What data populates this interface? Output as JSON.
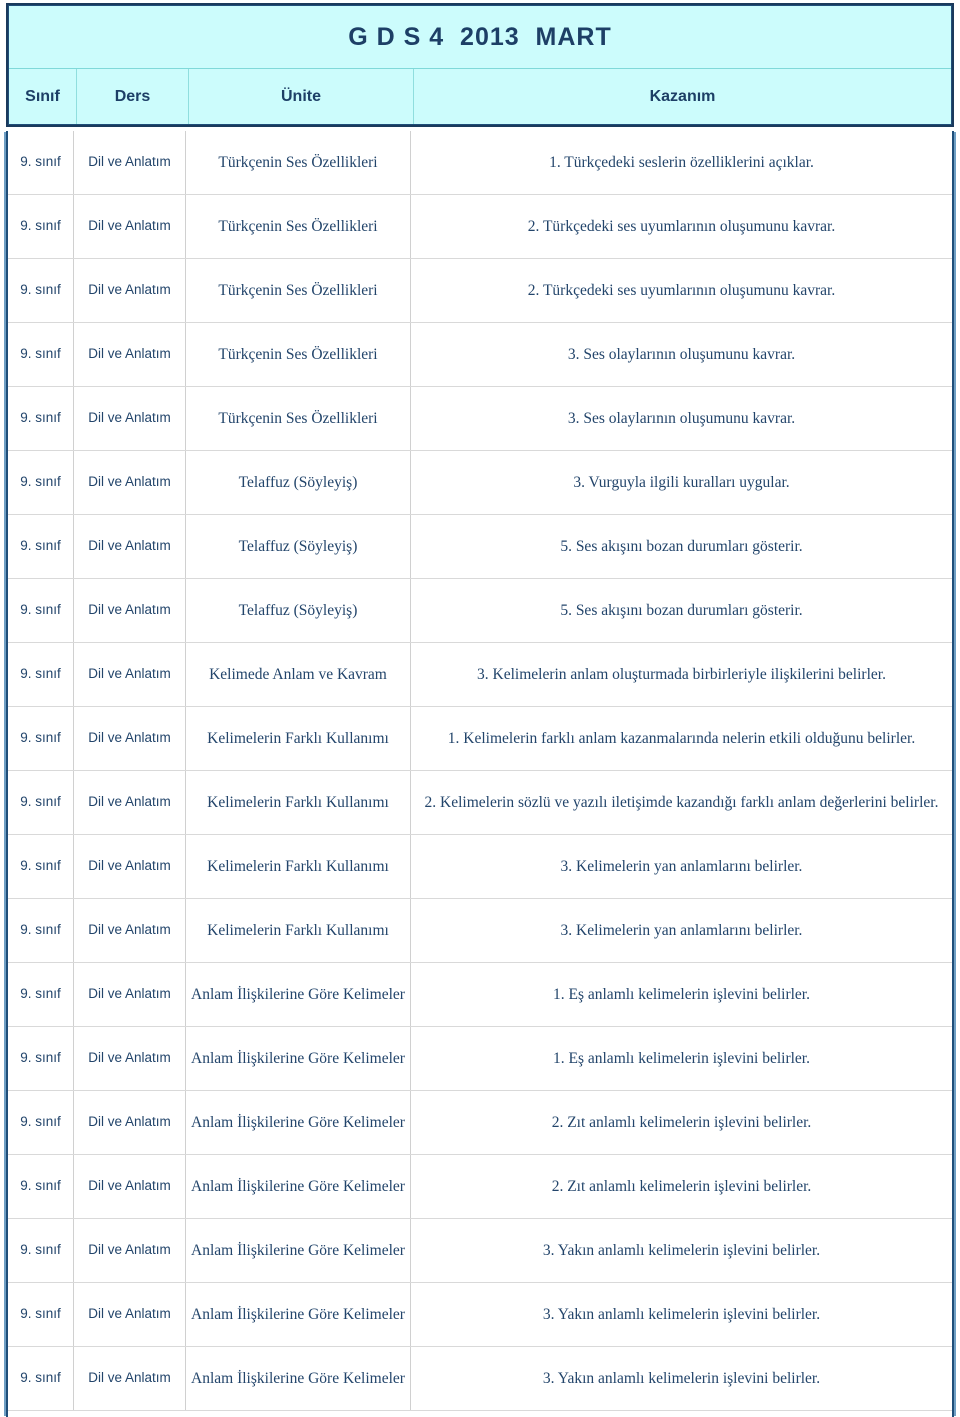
{
  "document": {
    "title": "G D S 4  2013  MART",
    "accent_header_bg": "#ccfcfc",
    "accent_text": "#1d3f66",
    "body_text": "#23456b",
    "border": "#1f4e79"
  },
  "table": {
    "columns": [
      {
        "key": "sinif",
        "label": "Sınıf"
      },
      {
        "key": "ders",
        "label": "Ders"
      },
      {
        "key": "unite",
        "label": "Ünite"
      },
      {
        "key": "kazanim",
        "label": "Kazanım"
      }
    ],
    "rows": [
      {
        "sinif": "9. sınıf",
        "ders": "Dil ve Anlatım",
        "unite": "Türkçenin Ses Özellikleri",
        "kazanim": "1. Türkçedeki seslerin özelliklerini açıklar."
      },
      {
        "sinif": "9. sınıf",
        "ders": "Dil ve Anlatım",
        "unite": "Türkçenin Ses Özellikleri",
        "kazanim": "2. Türkçedeki ses uyumlarının oluşumunu kavrar."
      },
      {
        "sinif": "9. sınıf",
        "ders": "Dil ve Anlatım",
        "unite": "Türkçenin Ses Özellikleri",
        "kazanim": "2. Türkçedeki ses uyumlarının oluşumunu kavrar."
      },
      {
        "sinif": "9. sınıf",
        "ders": "Dil ve Anlatım",
        "unite": "Türkçenin Ses Özellikleri",
        "kazanim": "3. Ses olaylarının oluşumunu kavrar."
      },
      {
        "sinif": "9. sınıf",
        "ders": "Dil ve Anlatım",
        "unite": "Türkçenin Ses Özellikleri",
        "kazanim": "3. Ses olaylarının oluşumunu kavrar."
      },
      {
        "sinif": "9. sınıf",
        "ders": "Dil ve Anlatım",
        "unite": "Telaffuz (Söyleyiş)",
        "kazanim": "3. Vurguyla ilgili kuralları uygular."
      },
      {
        "sinif": "9. sınıf",
        "ders": "Dil ve Anlatım",
        "unite": "Telaffuz (Söyleyiş)",
        "kazanim": "5. Ses akışını bozan durumları gösterir."
      },
      {
        "sinif": "9. sınıf",
        "ders": "Dil ve Anlatım",
        "unite": "Telaffuz (Söyleyiş)",
        "kazanim": "5. Ses akışını bozan durumları gösterir."
      },
      {
        "sinif": "9. sınıf",
        "ders": "Dil ve Anlatım",
        "unite": "Kelimede Anlam ve Kavram",
        "kazanim": "3. Kelimelerin anlam oluşturmada birbirleriyle ilişkilerini belirler."
      },
      {
        "sinif": "9. sınıf",
        "ders": "Dil ve Anlatım",
        "unite": "Kelimelerin Farklı  Kullanımı",
        "kazanim": "1. Kelimelerin farklı anlam kazanmalarında nelerin etkili olduğunu belirler."
      },
      {
        "sinif": "9. sınıf",
        "ders": "Dil ve Anlatım",
        "unite": "Kelimelerin Farklı  Kullanımı",
        "kazanim": "2. Kelimelerin sözlü ve yazılı iletişimde kazandığı farklı anlam değerlerini belirler."
      },
      {
        "sinif": "9. sınıf",
        "ders": "Dil ve Anlatım",
        "unite": "Kelimelerin Farklı  Kullanımı",
        "kazanim": "3. Kelimelerin yan anlamlarını belirler."
      },
      {
        "sinif": "9. sınıf",
        "ders": "Dil ve Anlatım",
        "unite": "Kelimelerin Farklı  Kullanımı",
        "kazanim": "3. Kelimelerin yan anlamlarını belirler."
      },
      {
        "sinif": "9. sınıf",
        "ders": "Dil ve Anlatım",
        "unite": "Anlam İlişkilerine Göre Kelimeler",
        "kazanim": "1. Eş anlamlı kelimelerin işlevini belirler."
      },
      {
        "sinif": "9. sınıf",
        "ders": "Dil ve Anlatım",
        "unite": "Anlam İlişkilerine Göre Kelimeler",
        "kazanim": "1. Eş anlamlı kelimelerin işlevini belirler."
      },
      {
        "sinif": "9. sınıf",
        "ders": "Dil ve Anlatım",
        "unite": "Anlam İlişkilerine Göre Kelimeler",
        "kazanim": "2. Zıt anlamlı kelimelerin işlevini belirler."
      },
      {
        "sinif": "9. sınıf",
        "ders": "Dil ve Anlatım",
        "unite": "Anlam İlişkilerine Göre Kelimeler",
        "kazanim": "2. Zıt anlamlı kelimelerin işlevini belirler."
      },
      {
        "sinif": "9. sınıf",
        "ders": "Dil ve Anlatım",
        "unite": "Anlam İlişkilerine Göre Kelimeler",
        "kazanim": "3. Yakın anlamlı kelimelerin işlevini belirler."
      },
      {
        "sinif": "9. sınıf",
        "ders": "Dil ve Anlatım",
        "unite": "Anlam İlişkilerine Göre Kelimeler",
        "kazanim": "3. Yakın anlamlı kelimelerin işlevini belirler."
      },
      {
        "sinif": "9. sınıf",
        "ders": "Dil ve Anlatım",
        "unite": "Anlam İlişkilerine Göre Kelimeler",
        "kazanim": "3. Yakın anlamlı kelimelerin işlevini belirler."
      }
    ]
  }
}
